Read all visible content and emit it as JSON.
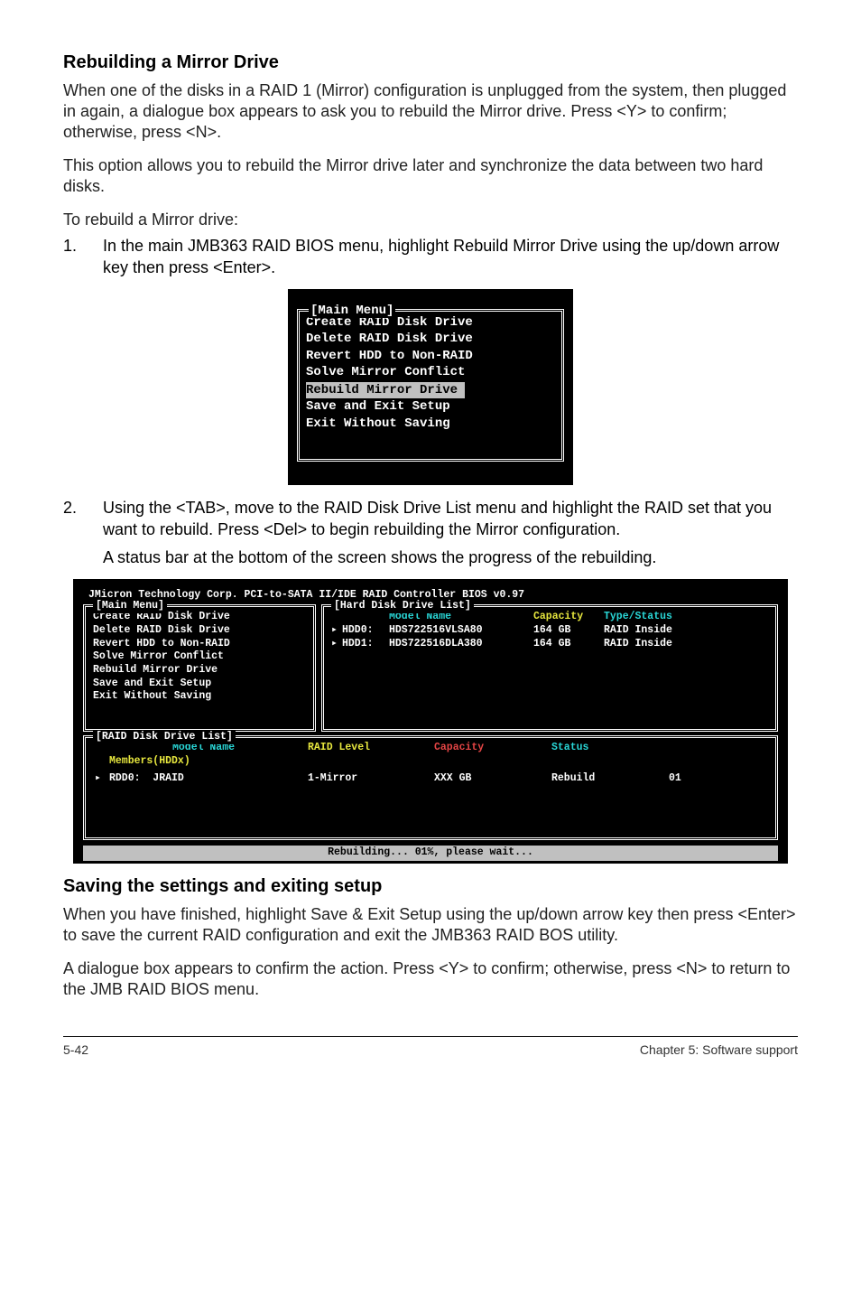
{
  "section1": {
    "title": "Rebuilding a Mirror Drive",
    "p1": "When one of the disks in a RAID 1 (Mirror) configuration is unplugged from the system, then plugged in again, a dialogue box appears to ask you to rebuild the Mirror drive. Press <Y> to confirm; otherwise, press <N>.",
    "p2": "This option allows you to rebuild the Mirror drive later and synchronize the data between two hard disks.",
    "p3": "To rebuild a Mirror drive:"
  },
  "step1": {
    "num": "1.",
    "text": "In the main JMB363 RAID BIOS menu, highlight Rebuild Mirror Drive using the up/down arrow key then press <Enter>."
  },
  "step2": {
    "num": "2.",
    "text": "Using the <TAB>, move to the RAID Disk Drive List menu and highlight the RAID set that you want to rebuild. Press <Del> to begin rebuilding the Mirror configuration.",
    "sub": "A status bar at the bottom of the screen shows the progress of the rebuilding."
  },
  "small_menu": {
    "legend": "[Main Menu]",
    "items": {
      "i0": "Create RAID Disk Drive",
      "i1": "Delete RAID Disk Drive",
      "i2": "Revert HDD to Non-RAID",
      "i3": "Solve Mirror Conflict",
      "i4": "Rebuild Mirror Drive",
      "i5": "Save and Exit Setup",
      "i6": "Exit Without Saving"
    }
  },
  "big_bios": {
    "title": "JMicron Technology Corp. PCI-to-SATA II/IDE RAID Controller BIOS v0.97",
    "main_legend": "[Main Menu]",
    "main": {
      "m0": "Create RAID Disk Drive",
      "m1": "Delete RAID Disk Drive",
      "m2": "Revert HDD to Non-RAID",
      "m3": "Solve Mirror Conflict",
      "m4": "Rebuild Mirror Drive",
      "m5": "Save and Exit Setup",
      "m6": "Exit Without Saving"
    },
    "hdd": {
      "legend": "[Hard Disk Drive List]",
      "header": {
        "model": "Model Name",
        "cap": "Capacity",
        "type": "Type/Status"
      },
      "r0": {
        "arrow": "▸",
        "idx": "HDD0:",
        "model": "HDS722516VLSA80",
        "cap": "164 GB",
        "type": "RAID Inside"
      },
      "r1": {
        "arrow": "▸",
        "idx": "HDD1:",
        "model": "HDS722516DLA380",
        "cap": "164 GB",
        "type": "RAID Inside"
      }
    },
    "raid": {
      "legend": "[RAID Disk Drive List]",
      "header": {
        "name": "Model Name",
        "level": "RAID Level",
        "cap": "Capacity",
        "status": "Status"
      },
      "members_label": "Members(HDDx)",
      "r0": {
        "arrow": "▸",
        "name": "RDD0:  JRAID",
        "level": "1-Mirror",
        "cap": "XXX GB",
        "status": "Rebuild",
        "members": "01"
      }
    },
    "footer": "Rebuilding... 01%, please wait..."
  },
  "section2": {
    "title": "Saving the settings and exiting setup",
    "p1": "When you have finished, highlight Save & Exit Setup using the up/down arrow key then press <Enter> to save the current RAID configuration and exit the JMB363 RAID BOS utility.",
    "p2": "A dialogue box appears to confirm the action. Press <Y> to confirm; otherwise, press <N> to return to the JMB RAID BIOS menu."
  },
  "footer": {
    "left": "5-42",
    "right": "Chapter 5: Software support"
  }
}
